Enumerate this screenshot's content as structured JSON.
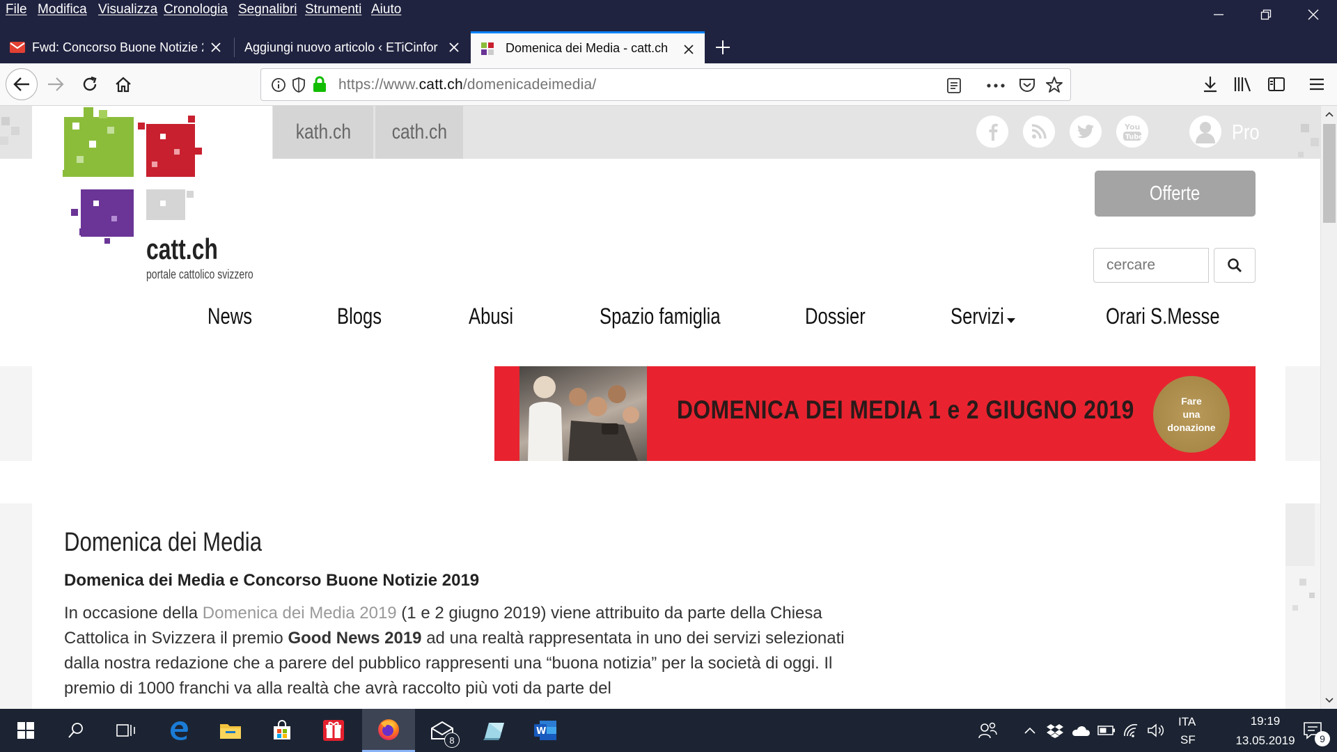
{
  "browser": {
    "menu": [
      "File",
      "Modifica",
      "Visualizza",
      "Cronologia",
      "Segnalibri",
      "Strumenti",
      "Aiuto"
    ],
    "tabs": [
      {
        "title": "Fwd: Concorso Buone Notizie 2",
        "icon": "gmail-icon"
      },
      {
        "title": "Aggiungi nuovo articolo ‹ ETiCinfor",
        "icon": "none"
      },
      {
        "title": "Domenica dei Media - catt.ch",
        "icon": "catt-favicon",
        "active": true
      }
    ],
    "url": {
      "prefix": "https://www.",
      "domain": "catt.ch",
      "path": "/domenicadeimedia/"
    },
    "accent": "#0a84ff"
  },
  "site": {
    "logo": {
      "name": "catt.ch",
      "tagline": "portale cattolico svizzero",
      "colors": [
        "#8bbd3b",
        "#c8202f",
        "#6a3596",
        "#cccccc"
      ]
    },
    "portals": [
      "kath.ch",
      "cath.ch"
    ],
    "social": [
      "facebook-icon",
      "rss-icon",
      "twitter-icon",
      "youtube-icon"
    ],
    "pro_label": "Pro",
    "offers_label": "Offerte",
    "search_placeholder": "cercare",
    "nav": [
      "News",
      "Blogs",
      "Abusi",
      "Spazio famiglia",
      "Dossier",
      "Servizi",
      "Orari S.Messe"
    ],
    "banner": {
      "text": "DOMENICA DEI MEDIA 1 e 2 GIUGNO 2019",
      "donate": [
        "Fare",
        "una",
        "donazione"
      ]
    }
  },
  "article": {
    "title": "Domenica dei Media",
    "subtitle": "Domenica dei Media e Concorso Buone Notizie 2019",
    "p1_a": "In occasione della ",
    "p1_link": "Domenica dei Media 2019",
    "p1_b": " (1 e 2 giugno 2019) viene attribuito da parte della Chiesa Cattolica in Svizzera il premio ",
    "p1_bold": "Good News 2019",
    "p1_c": " ad una realtà rappresentata in uno dei servizi selezionati dalla nostra redazione che a parere del pubblico rappresenti una “buona notizia” per la società di oggi. Il premio di 1000 franchi va alla realtà che avrà raccolto più voti da parte del"
  },
  "taskbar": {
    "mail_badge": "8",
    "lang": "ITA",
    "layout": "SF",
    "time": "19:19",
    "date": "13.05.2019",
    "notif_count": "9"
  }
}
